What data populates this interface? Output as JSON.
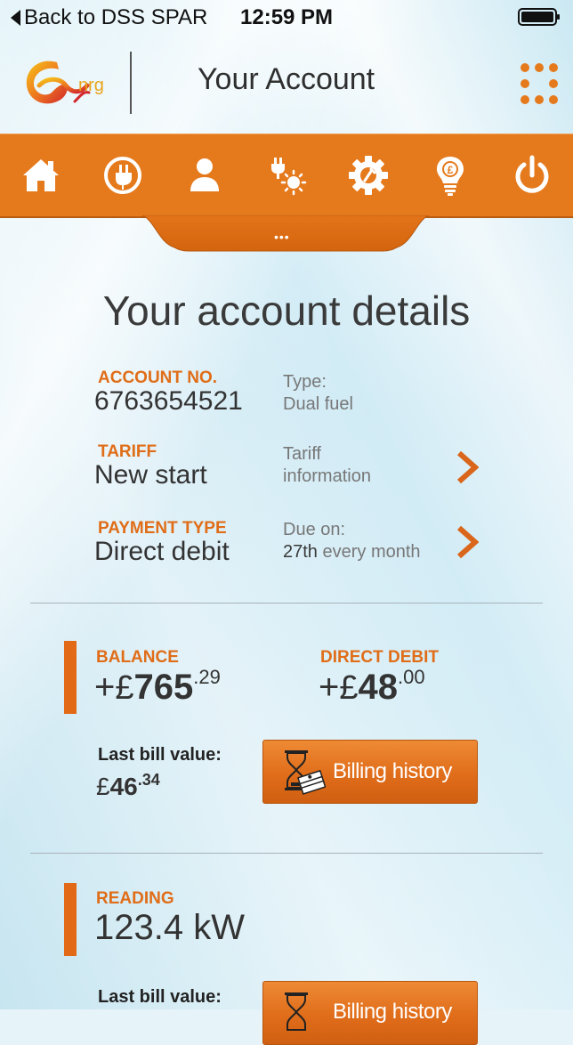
{
  "status_bar": {
    "back_label": "Back to DSS SPAR",
    "time": "12:59 PM"
  },
  "header": {
    "logo_text": "nrg",
    "title": "Your Account"
  },
  "nav": {
    "items": [
      {
        "name": "home-icon"
      },
      {
        "name": "plug-icon"
      },
      {
        "name": "user-icon"
      },
      {
        "name": "energy-icon"
      },
      {
        "name": "gear-icon"
      },
      {
        "name": "lightbulb-pound-icon"
      },
      {
        "name": "power-icon"
      }
    ],
    "handle_dots": "•••"
  },
  "colors": {
    "accent": "#e57a1d",
    "label_orange": "#e06d18"
  },
  "details": {
    "title": "Your account details",
    "account_no_label": "ACCOUNT NO.",
    "account_no": "6763654521",
    "type_label": "Type:",
    "type_value": "Dual fuel",
    "tariff_label": "TARIFF",
    "tariff_value": "New start",
    "tariff_info_line1": "Tariff",
    "tariff_info_line2": "information",
    "payment_label": "PAYMENT TYPE",
    "payment_value": "Direct debit",
    "due_label": "Due on:",
    "due_day": "27th",
    "due_suffix": " every month"
  },
  "balance": {
    "label": "BALANCE",
    "sign": "+",
    "currency": "£",
    "int": "765",
    "dec": ".29",
    "dd_label": "DIRECT DEBIT",
    "dd_sign": "+",
    "dd_currency": "£",
    "dd_int": "48",
    "dd_dec": ".00",
    "last_bill_label": "Last bill value:",
    "last_bill_currency": "£",
    "last_bill_int": "46",
    "last_bill_dec": ".34",
    "billing_history": "Billing history"
  },
  "reading": {
    "label": "READING",
    "value": "123.4 kW",
    "last_bill_label": "Last bill value:",
    "billing_history": "Billing history"
  }
}
